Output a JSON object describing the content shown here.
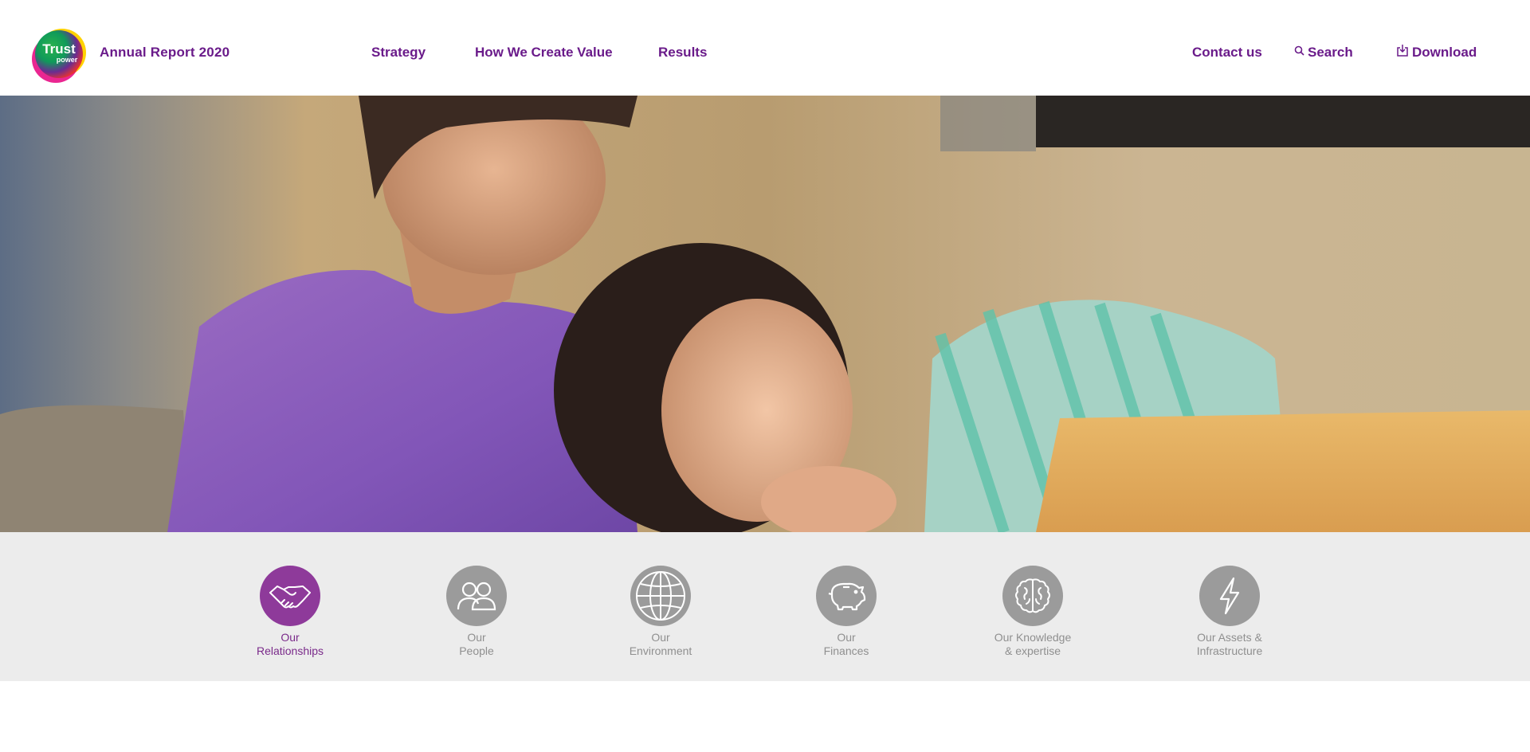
{
  "brand": {
    "logo_text_1": "Trust",
    "logo_text_2": "power",
    "title": "Annual Report 2020",
    "colors": {
      "primary": "#6a1b8a",
      "active_icon": "#8e3a9a",
      "inactive_icon": "#9b9b9b"
    }
  },
  "nav": {
    "items": [
      {
        "label": "Strategy"
      },
      {
        "label": "How We Create Value"
      },
      {
        "label": "Results"
      }
    ],
    "contact": "Contact us",
    "search": "Search",
    "search_icon": "search-icon",
    "download": "Download",
    "download_icon": "download-icon"
  },
  "hero": {
    "image_description": ""
  },
  "capitals": [
    {
      "label": "Our\nRelationships",
      "icon": "handshake-icon",
      "active": true
    },
    {
      "label": "Our\nPeople",
      "icon": "people-icon",
      "active": false
    },
    {
      "label": "Our\nEnvironment",
      "icon": "globe-icon",
      "active": false
    },
    {
      "label": "Our\nFinances",
      "icon": "piggy-bank-icon",
      "active": false
    },
    {
      "label": "Our Knowledge\n& expertise",
      "icon": "brain-icon",
      "active": false
    },
    {
      "label": "Our Assets &\nInfrastructure",
      "icon": "lightning-icon",
      "active": false
    }
  ]
}
